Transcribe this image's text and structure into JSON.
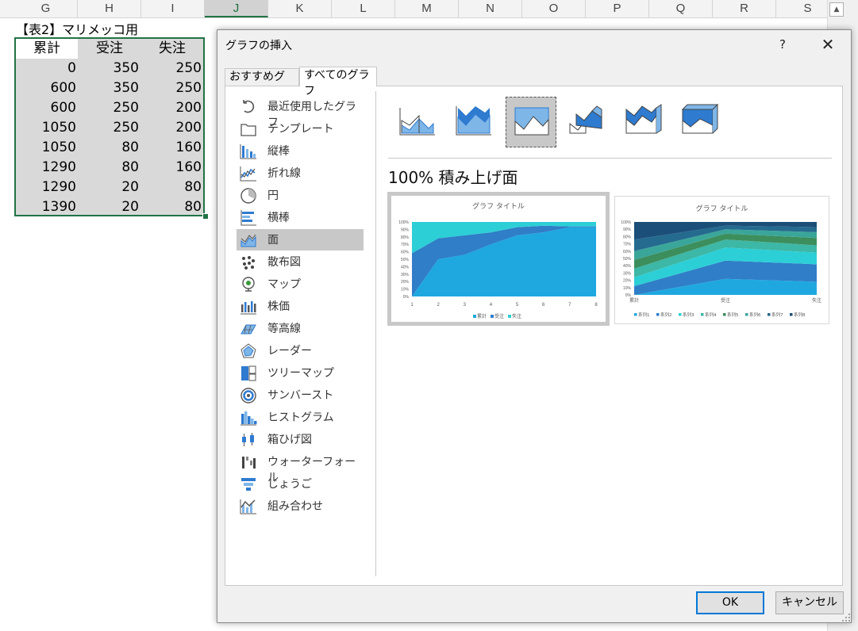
{
  "excel": {
    "columns": [
      "G",
      "H",
      "I",
      "J",
      "K",
      "L",
      "M",
      "N",
      "O",
      "P",
      "Q",
      "R",
      "S"
    ],
    "selected_column": "J",
    "sheet_title": "【表2】マリメッコ用",
    "table": {
      "headers": [
        "累計",
        "受注",
        "失注"
      ],
      "rows": [
        [
          "0",
          "350",
          "250"
        ],
        [
          "600",
          "350",
          "250"
        ],
        [
          "600",
          "250",
          "200"
        ],
        [
          "1050",
          "250",
          "200"
        ],
        [
          "1050",
          "80",
          "160"
        ],
        [
          "1290",
          "80",
          "160"
        ],
        [
          "1290",
          "20",
          "80"
        ],
        [
          "1390",
          "20",
          "80"
        ]
      ]
    }
  },
  "dialog": {
    "title": "グラフの挿入",
    "help": "?",
    "close": "✕",
    "tabs": [
      "おすすめグラフ",
      "すべてのグラフ"
    ],
    "active_tab": 1,
    "categories": [
      {
        "label": "最近使用したグラフ",
        "icon": "recent-icon"
      },
      {
        "label": "テンプレート",
        "icon": "folder-icon"
      },
      {
        "label": "縦棒",
        "icon": "column-chart-icon"
      },
      {
        "label": "折れ線",
        "icon": "line-chart-icon"
      },
      {
        "label": "円",
        "icon": "pie-chart-icon"
      },
      {
        "label": "横棒",
        "icon": "bar-chart-icon"
      },
      {
        "label": "面",
        "icon": "area-chart-icon"
      },
      {
        "label": "散布図",
        "icon": "scatter-chart-icon"
      },
      {
        "label": "マップ",
        "icon": "map-icon"
      },
      {
        "label": "株価",
        "icon": "stock-chart-icon"
      },
      {
        "label": "等高線",
        "icon": "surface-chart-icon"
      },
      {
        "label": "レーダー",
        "icon": "radar-chart-icon"
      },
      {
        "label": "ツリーマップ",
        "icon": "treemap-icon"
      },
      {
        "label": "サンバースト",
        "icon": "sunburst-icon"
      },
      {
        "label": "ヒストグラム",
        "icon": "histogram-icon"
      },
      {
        "label": "箱ひげ図",
        "icon": "box-whisker-icon"
      },
      {
        "label": "ウォーターフォール",
        "icon": "waterfall-icon"
      },
      {
        "label": "じょうご",
        "icon": "funnel-icon"
      },
      {
        "label": "組み合わせ",
        "icon": "combo-chart-icon"
      }
    ],
    "selected_category": 6,
    "subtypes": [
      "area",
      "stacked-area",
      "100-stacked-area",
      "3d-area",
      "3d-stacked-area",
      "3d-100-stacked-area"
    ],
    "selected_subtype": 2,
    "subtype_title": "100% 積み上げ面",
    "ok_label": "OK",
    "cancel_label": "キャンセル",
    "accent": "#0078d7",
    "area_colors": [
      "#1fa8e0",
      "#2f7ec7",
      "#2ccfd6"
    ]
  },
  "chart_data": [
    {
      "type": "area",
      "title": "グラフ タイトル",
      "x": [
        "1",
        "2",
        "3",
        "4",
        "5",
        "6",
        "7",
        "8"
      ],
      "y_ticks": [
        "0%",
        "10%",
        "20%",
        "30%",
        "40%",
        "50%",
        "60%",
        "70%",
        "80%",
        "90%",
        "100%"
      ],
      "ylim": [
        0,
        100
      ],
      "series": [
        {
          "name": "累計",
          "values": [
            0,
            50,
            56,
            70,
            82,
            86,
            93,
            93
          ],
          "color": "#1fa8e0"
        },
        {
          "name": "受注",
          "values": [
            58,
            28,
            26,
            16,
            11,
            9,
            1,
            1
          ],
          "color": "#2f7ec7"
        },
        {
          "name": "失注",
          "values": [
            42,
            22,
            18,
            14,
            7,
            5,
            6,
            6
          ],
          "color": "#2ccfd6"
        }
      ]
    },
    {
      "type": "area",
      "title": "グラフ タイトル",
      "categories": [
        "累計",
        "受注",
        "失注"
      ],
      "y_ticks": [
        "0%",
        "10%",
        "20%",
        "30%",
        "40%",
        "50%",
        "60%",
        "70%",
        "80%",
        "90%",
        "100%"
      ],
      "ylim": [
        0,
        100
      ],
      "series": [
        {
          "name": "系列1",
          "values": [
            0,
            22,
            18
          ],
          "color": "#1fa8e0"
        },
        {
          "name": "系列2",
          "values": [
            12,
            25,
            24
          ],
          "color": "#2f7ec7"
        },
        {
          "name": "系列3",
          "values": [
            12,
            18,
            16
          ],
          "color": "#2ccfd6"
        },
        {
          "name": "系列4",
          "values": [
            12,
            11,
            10
          ],
          "color": "#3db7a6"
        },
        {
          "name": "系列5",
          "values": [
            12,
            8,
            10
          ],
          "color": "#3c8e5c"
        },
        {
          "name": "系列6",
          "values": [
            12,
            6,
            8
          ],
          "color": "#3aa69a"
        },
        {
          "name": "系列7",
          "values": [
            16,
            5,
            7
          ],
          "color": "#256a8f"
        },
        {
          "name": "系列8",
          "values": [
            24,
            5,
            7
          ],
          "color": "#1b4e78"
        }
      ]
    }
  ]
}
